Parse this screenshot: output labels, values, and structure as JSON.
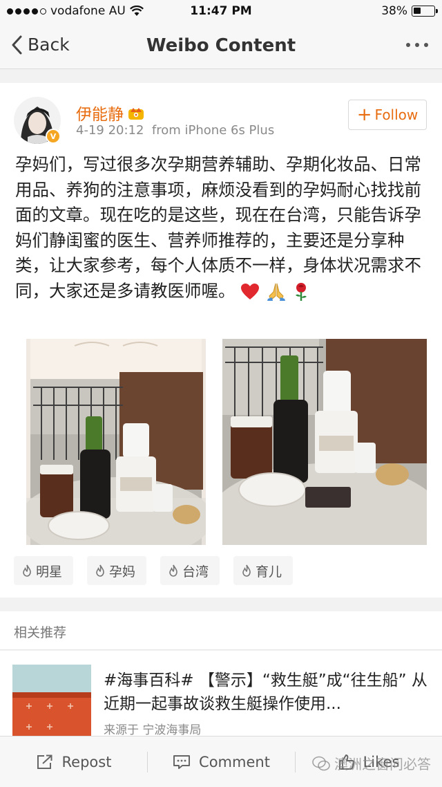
{
  "status_bar": {
    "carrier": "vodafone AU",
    "time": "11:47 PM",
    "battery_text": "38%",
    "battery_level": 0.38
  },
  "nav": {
    "back_label": "Back",
    "title": "Weibo Content"
  },
  "post": {
    "username": "伊能静",
    "timestamp": "4-19 20:12",
    "source": "from iPhone 6s Plus",
    "follow_label": "Follow",
    "text": "孕妈们，写过很多次孕期营养辅助、孕期化妆品、日常用品、养狗的注意事项，麻烦没看到的孕妈耐心找找前面的文章。现在吃的是这些，现在在台湾，只能告诉孕妈们静闺蜜的医生、营养师推荐的，主要还是分享种类，让大家参考，每个人体质不一样，身体状况需求不同，大家还是多请教医师喔。",
    "emojis": [
      "heart-emoji",
      "pray-emoji",
      "rose-emoji"
    ],
    "tags": [
      "明星",
      "孕妈",
      "台湾",
      "育儿"
    ]
  },
  "related": {
    "header": "相关推荐",
    "item_title": "#海事百科# 【警示】“救生艇”成“往生船” 从近期一起事故谈救生艇操作使用...",
    "item_source": "来源于 宁波海事局"
  },
  "toolbar": {
    "repost_label": "Repost",
    "comment_label": "Comment",
    "likes_label": "Likes"
  },
  "watermark": "澳洲之窗问必答",
  "colors": {
    "accent": "#e86c10",
    "text": "#222222",
    "muted": "#8a8a8a",
    "bar_bg": "#f7f7f7",
    "page_bg": "#f2f2f2"
  }
}
